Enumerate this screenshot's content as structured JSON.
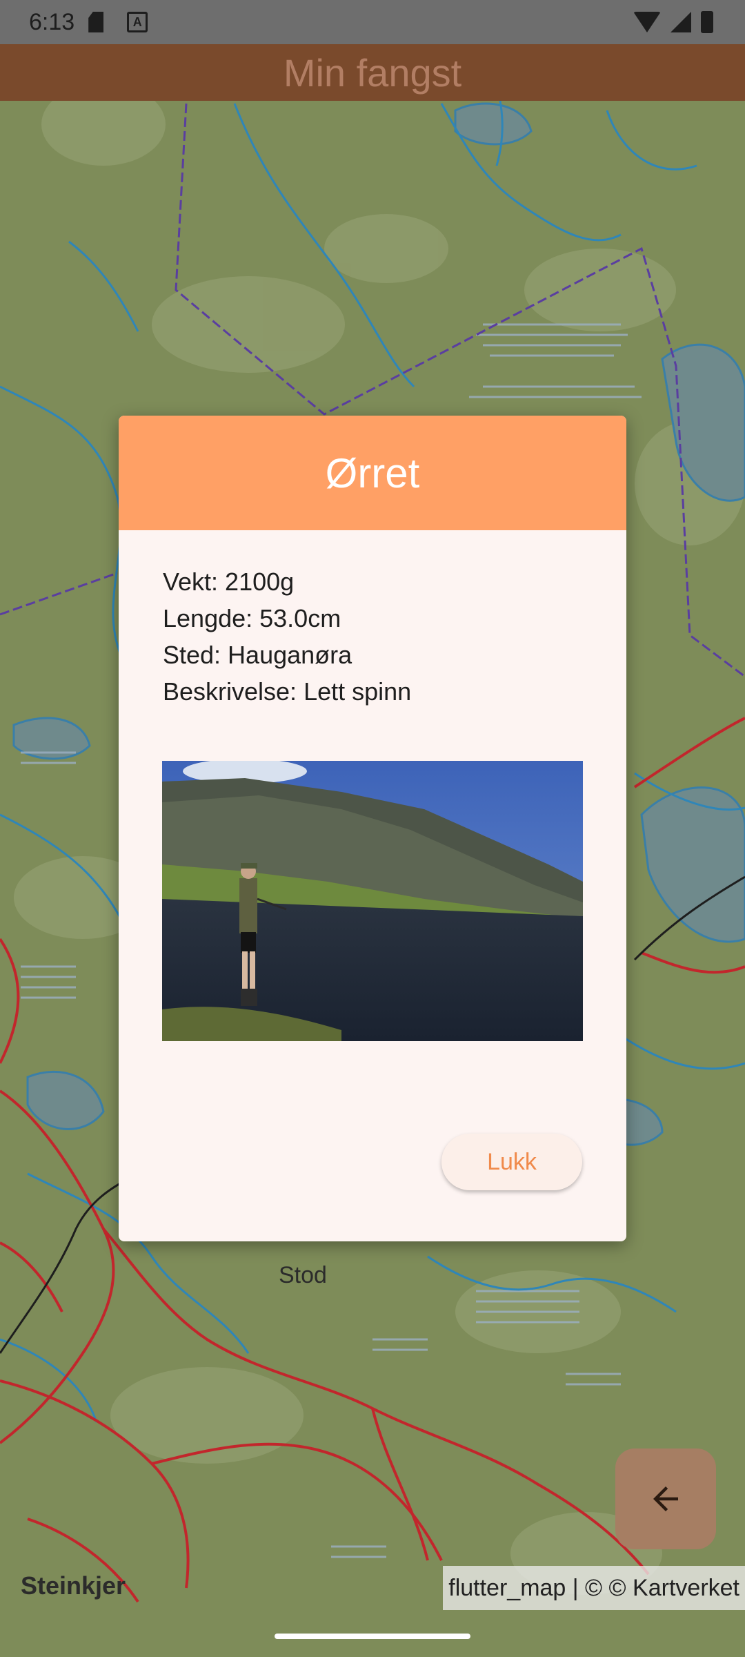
{
  "status_bar": {
    "time": "6:13"
  },
  "app_bar": {
    "title": "Min fangst"
  },
  "map": {
    "labels": {
      "stod": "Stod",
      "steinkjer": "Steinkjer"
    },
    "attribution": "flutter_map | © © Kartverket"
  },
  "dialog": {
    "title": "Ørret",
    "details": [
      "Vekt: 2100g",
      "Lengde: 53.0cm",
      "Sted: Hauganøra",
      "Beskrivelse: Lett spinn"
    ],
    "close_label": "Lukk"
  },
  "fab": {
    "icon": "arrow-back-icon"
  },
  "colors": {
    "dialog_header": "#ffa065",
    "accent_text": "#f08a4b",
    "app_bar": "#7a4a2c"
  }
}
